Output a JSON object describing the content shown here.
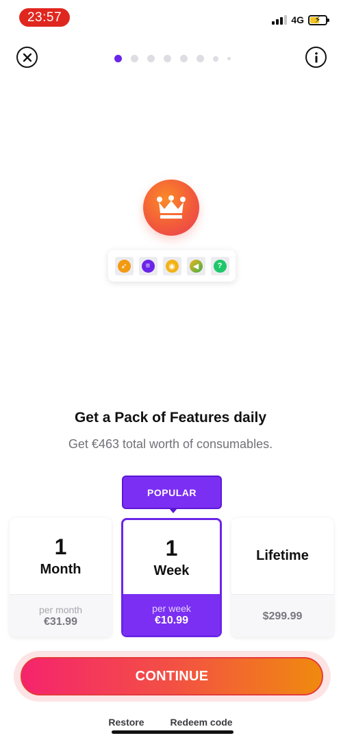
{
  "status_bar": {
    "time": "23:57",
    "network": "4G",
    "battery_color": "#f2c522"
  },
  "top_bar": {
    "close_icon": "close-icon",
    "info_icon": "info-icon",
    "page_dots": {
      "count": 8,
      "active_index": 0
    }
  },
  "illustration": {
    "badge_icon": "crown-icon",
    "features": [
      {
        "icon": "rocket-icon",
        "color": "#f29a12"
      },
      {
        "icon": "chat-icon",
        "color": "#6a25e8"
      },
      {
        "icon": "eye-icon",
        "color": "#f2b314"
      },
      {
        "icon": "rewind-icon",
        "color": "#5fb33a"
      },
      {
        "icon": "question-icon",
        "color": "#1fc76a"
      }
    ]
  },
  "headline": "Get a Pack of Features daily",
  "subline": "Get €463 total worth of consumables.",
  "plans": {
    "popular_label": "POPULAR",
    "month": {
      "num": "1",
      "unit": "Month",
      "per": "per month",
      "price": "€31.99"
    },
    "week": {
      "num": "1",
      "unit": "Week",
      "per": "per week",
      "price": "€10.99"
    },
    "lifetime": {
      "label": "Lifetime",
      "price": "$299.99"
    }
  },
  "continue_label": "CONTINUE",
  "links": {
    "restore": "Restore",
    "redeem": "Redeem code"
  },
  "colors": {
    "accent": "#6a25e8",
    "gradient_start": "#f5246d",
    "gradient_end": "#f08a0e"
  }
}
